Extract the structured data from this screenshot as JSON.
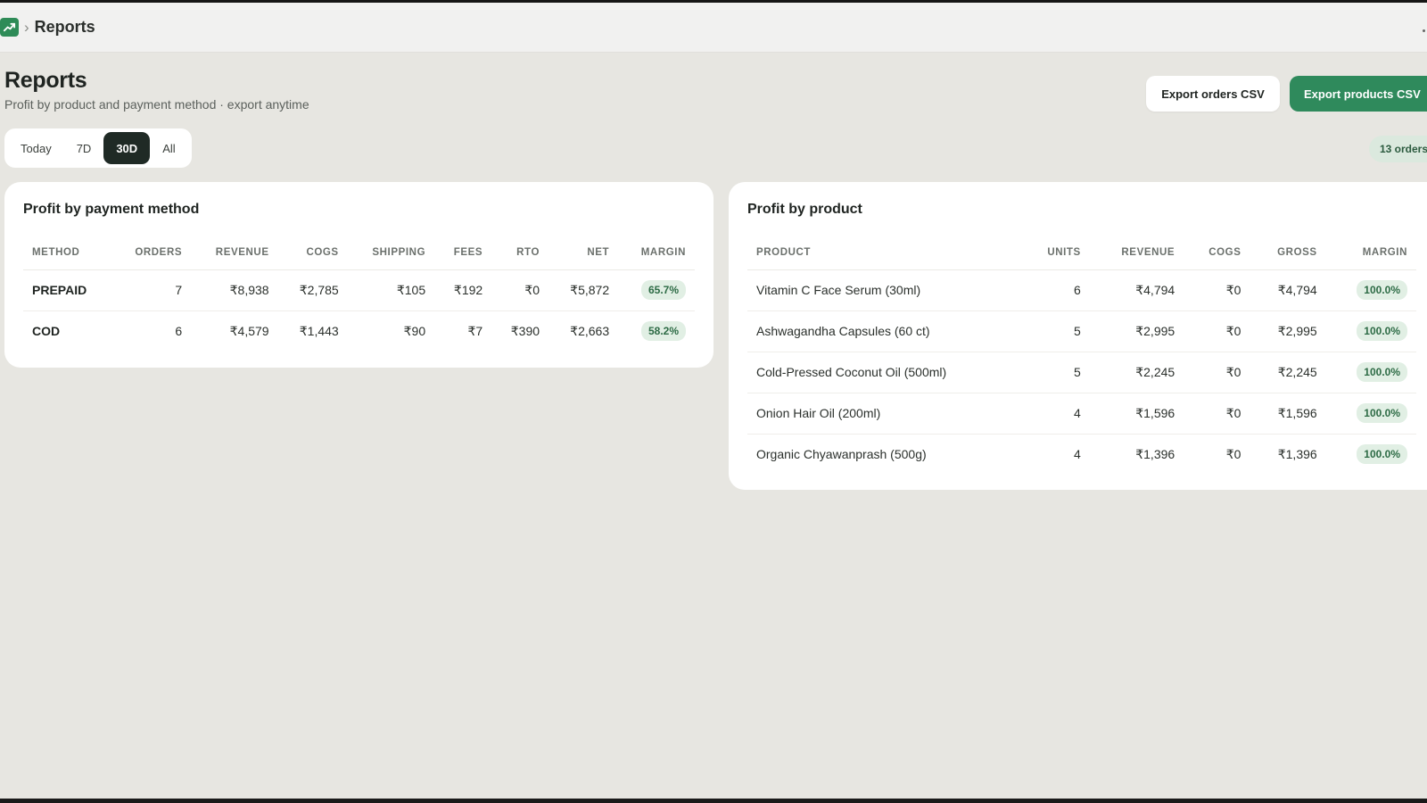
{
  "breadcrumb": {
    "current": "Reports"
  },
  "header": {
    "title": "Reports",
    "subtitle": "Profit by product and payment method · export anytime"
  },
  "actions": {
    "export_orders": "Export orders CSV",
    "export_products": "Export products CSV"
  },
  "range_tabs": [
    {
      "label": "Today",
      "active": false
    },
    {
      "label": "7D",
      "active": false
    },
    {
      "label": "30D",
      "active": true
    },
    {
      "label": "All",
      "active": false
    }
  ],
  "orders_count": "13 orders",
  "payment_table": {
    "title": "Profit by payment method",
    "columns": [
      "METHOD",
      "ORDERS",
      "REVENUE",
      "COGS",
      "SHIPPING",
      "FEES",
      "RTO",
      "NET",
      "MARGIN"
    ],
    "rows": [
      {
        "method": "PREPAID",
        "orders": "7",
        "revenue": "₹8,938",
        "cogs": "₹2,785",
        "shipping": "₹105",
        "fees": "₹192",
        "rto": "₹0",
        "net": "₹5,872",
        "margin": "65.7%"
      },
      {
        "method": "COD",
        "orders": "6",
        "revenue": "₹4,579",
        "cogs": "₹1,443",
        "shipping": "₹90",
        "fees": "₹7",
        "rto": "₹390",
        "net": "₹2,663",
        "margin": "58.2%"
      }
    ]
  },
  "product_table": {
    "title": "Profit by product",
    "columns": [
      "PRODUCT",
      "UNITS",
      "REVENUE",
      "COGS",
      "GROSS",
      "MARGIN"
    ],
    "rows": [
      {
        "product": "Vitamin C Face Serum (30ml)",
        "units": "6",
        "revenue": "₹4,794",
        "cogs": "₹0",
        "gross": "₹4,794",
        "margin": "100.0%"
      },
      {
        "product": "Ashwagandha Capsules (60 ct)",
        "units": "5",
        "revenue": "₹2,995",
        "cogs": "₹0",
        "gross": "₹2,995",
        "margin": "100.0%"
      },
      {
        "product": "Cold-Pressed Coconut Oil (500ml)",
        "units": "5",
        "revenue": "₹2,245",
        "cogs": "₹0",
        "gross": "₹2,245",
        "margin": "100.0%"
      },
      {
        "product": "Onion Hair Oil (200ml)",
        "units": "4",
        "revenue": "₹1,596",
        "cogs": "₹0",
        "gross": "₹1,596",
        "margin": "100.0%"
      },
      {
        "product": "Organic Chyawanprash (500g)",
        "units": "4",
        "revenue": "₹1,396",
        "cogs": "₹0",
        "gross": "₹1,396",
        "margin": "100.0%"
      }
    ]
  },
  "icons": {
    "app": "trending-up-icon",
    "separator": "chevron-right-icon"
  },
  "colors": {
    "accent": "#2f8a5c",
    "active_tab": "#1f2a25",
    "badge_bg": "#e1efe4",
    "background": "#e7e6e1"
  }
}
